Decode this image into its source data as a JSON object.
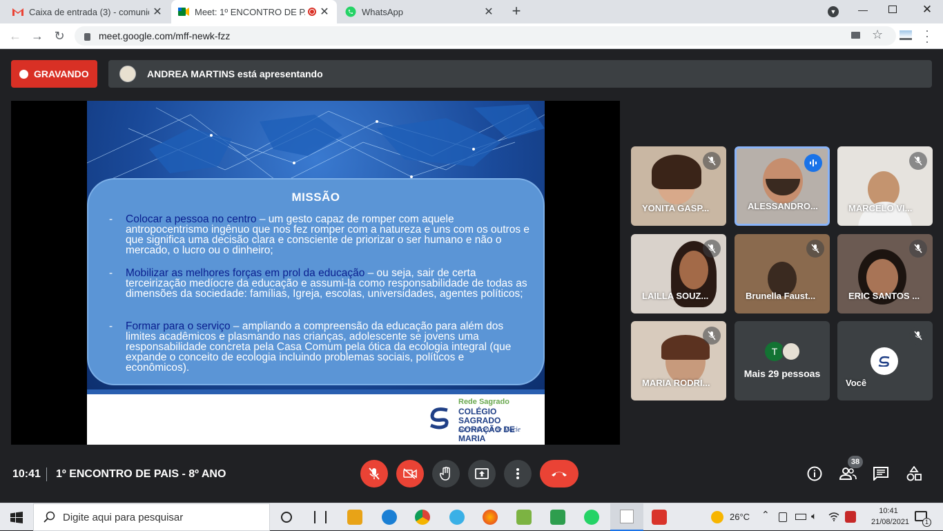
{
  "browser": {
    "tabs": [
      {
        "title": "Caixa de entrada (3) - comunicac",
        "icon": "gmail-icon"
      },
      {
        "title": "Meet: 1º ENCONTRO DE PAIS",
        "icon": "meet-icon",
        "recording": true
      },
      {
        "title": "WhatsApp",
        "icon": "whatsapp-icon"
      }
    ],
    "url": "meet.google.com/mff-newk-fzz"
  },
  "meet": {
    "recording_label": "GRAVANDO",
    "presenting_text": "ANDREA MARTINS está apresentando",
    "slide": {
      "heading": "MISSÃO",
      "items": [
        {
          "highlight": "Colocar a pessoa no centro",
          "text": " – um gesto capaz de romper com aquele antropocentrismo ingênuo que nos fez romper com a natureza e uns com os outros e que significa uma decisão clara e consciente de priorizar o ser humano e não o mercado, o lucro ou o dinheiro;"
        },
        {
          "highlight": "Mobilizar as melhores forças em prol da educação",
          "text": " – ou seja, sair de certa terceirização medíocre da educação e assumi-la como responsabilidade de todas as dimensões da sociedade: famílias, Igreja, escolas, universidades, agentes políticos;"
        },
        {
          "highlight": "Formar para o serviço",
          "text": " – ampliando a compreensão da educação para além dos limites acadêmicos e plasmando nas crianças, adolescente se jovens uma responsabilidade concreta pela Casa Comum pela ótica da ecologia integral (que expande o conceito de ecologia incluindo problemas sociais, políticos e econômicos)."
        }
      ],
      "logo": {
        "line1": "Rede Sagrado",
        "line2": "COLÉGIO SAGRADO",
        "line3": "CORAÇÃO DE MARIA",
        "line4": "Sacré-Coeur de Marie"
      }
    },
    "participants": [
      {
        "name": "YONITA GASP...",
        "muted": true
      },
      {
        "name": "ALESSANDRO...",
        "speaking": true
      },
      {
        "name": "MARCELO VI...",
        "muted": true
      },
      {
        "name": "LAILLA SOUZ...",
        "muted": true
      },
      {
        "name": "Brunella Faust...",
        "muted": true
      },
      {
        "name": "ERIC SANTOS ...",
        "muted": true
      },
      {
        "name": "MARIA RODRI...",
        "muted": true
      },
      {
        "name": "Mais 29 pessoas",
        "avatar_letter": "T"
      },
      {
        "name": "Você",
        "muted": true
      }
    ],
    "time": "10:41",
    "meeting_title": "1º ENCONTRO DE PAIS - 8º ANO",
    "people_count": "38",
    "controls": [
      "mic-off",
      "camera-off",
      "raise-hand",
      "present",
      "more",
      "leave-call"
    ],
    "right_controls": [
      "info",
      "people",
      "chat",
      "activities"
    ]
  },
  "taskbar": {
    "search_placeholder": "Digite aqui para pesquisar",
    "temperature": "26°C",
    "time": "10:41",
    "date": "21/08/2021",
    "notifications": "1"
  },
  "colors": {
    "recording": "#d93025",
    "leave": "#ea4335",
    "meet_bg": "#202124",
    "speaking": "#8ab4f8"
  }
}
